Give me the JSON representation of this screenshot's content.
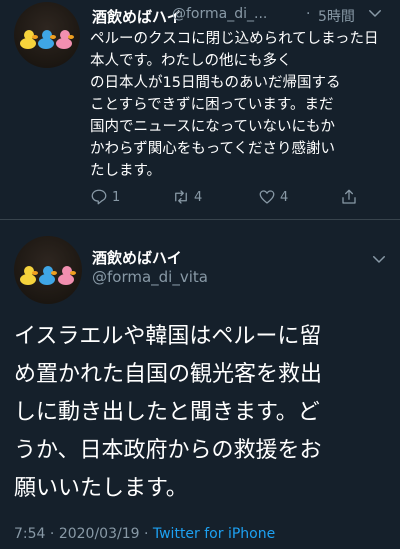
{
  "tweet1": {
    "display_name": "酒飲めばハイ",
    "handle": "@forma_di_...",
    "separator": "·",
    "time_ago": "5時間",
    "text": "ペルーのクスコに閉じ込められてしまった日本人です。わたしの他にも多く\nの日本人が15日間ものあいだ帰国する\nことすらできずに困っています。まだ\n国内でニュースになっていないにもか\nかわらず関心をもってくださり感謝い\nたします。",
    "reply_count": "1",
    "retweet_count": "4",
    "like_count": "4"
  },
  "tweet2": {
    "display_name": "酒飲めばハイ",
    "handle": "@forma_di_vita",
    "text": "イスラエルや韓国はペルーに留\nめ置かれた自国の観光客を救出\nしに動き出したと聞きます。ど\nうか、日本政府からの救援をお\n願いいたします。",
    "time": "7:54",
    "separator": "·",
    "date": "2020/03/19",
    "source": "Twitter for iPhone"
  },
  "icons": {
    "reply": "reply-icon",
    "retweet": "retweet-icon",
    "like": "heart-icon",
    "share": "share-icon",
    "more": "chevron-down-icon"
  },
  "colors": {
    "background": "#15202b",
    "secondary_text": "#8899a6",
    "link": "#1da1f2",
    "divider": "#38444d"
  }
}
